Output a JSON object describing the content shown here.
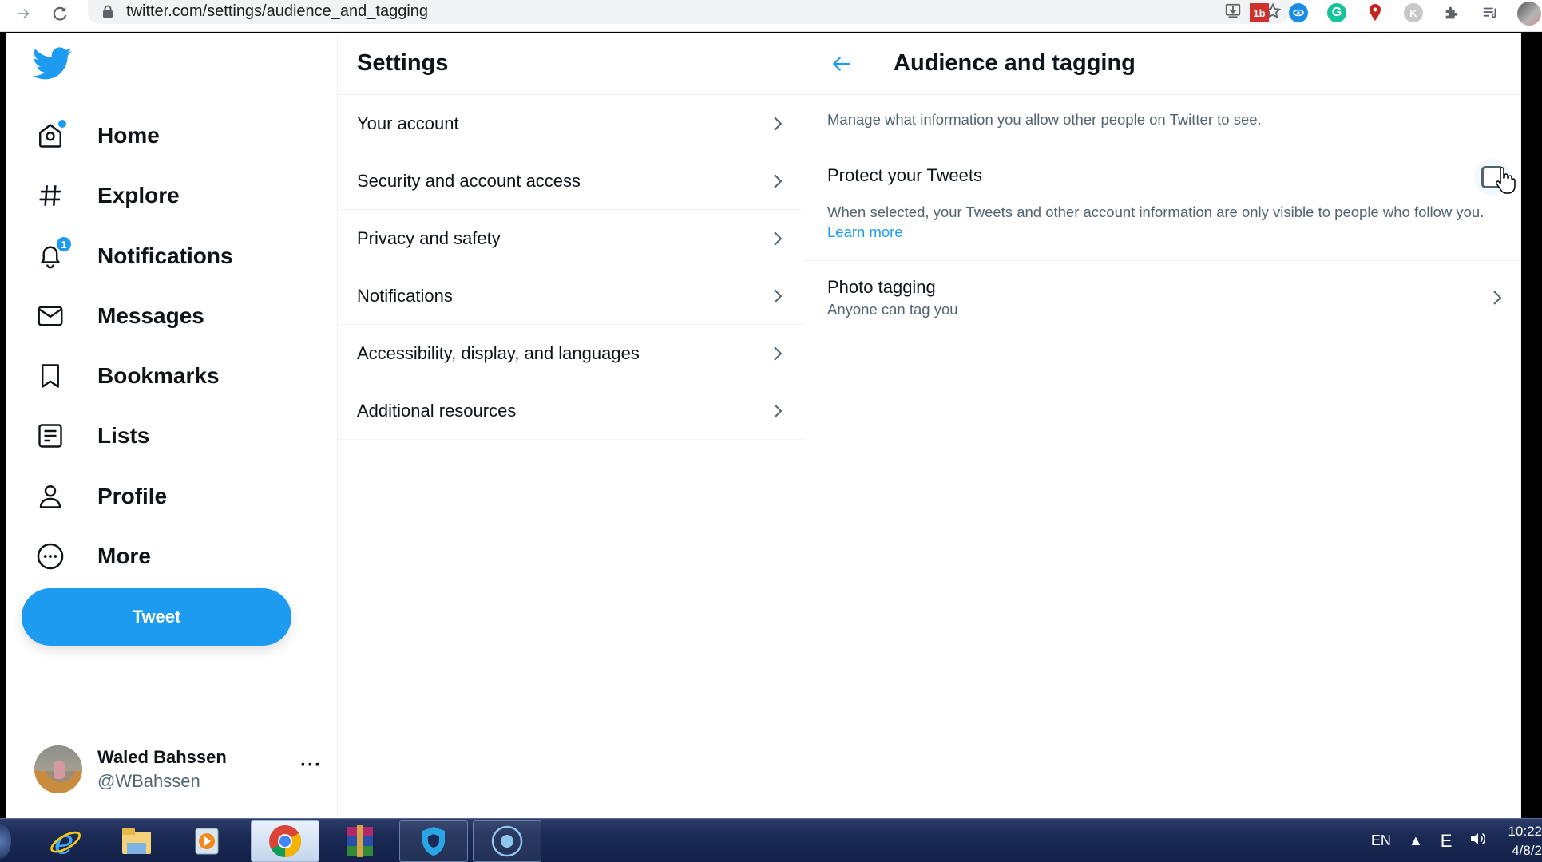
{
  "browser": {
    "url": "twitter.com/settings/audience_and_tagging",
    "icons": [
      "back-icon",
      "forward-icon",
      "reload-icon",
      "lock-icon",
      "install-icon",
      "star-icon",
      "extension-1b-icon",
      "extension-blue-icon",
      "grammarly-icon",
      "maps-pin-icon",
      "k-extension-icon",
      "puzzle-icon",
      "media-queue-icon",
      "profile-avatar-icon"
    ],
    "ext_labels": {
      "ext1": "1b",
      "grammarly": "G",
      "k": "K"
    }
  },
  "sidebar": {
    "items": [
      {
        "label": "Home",
        "icon": "home-icon",
        "has_dot": true
      },
      {
        "label": "Explore",
        "icon": "hashtag-icon"
      },
      {
        "label": "Notifications",
        "icon": "bell-icon",
        "badge": "1"
      },
      {
        "label": "Messages",
        "icon": "envelope-icon"
      },
      {
        "label": "Bookmarks",
        "icon": "bookmark-icon"
      },
      {
        "label": "Lists",
        "icon": "list-icon"
      },
      {
        "label": "Profile",
        "icon": "person-icon"
      },
      {
        "label": "More",
        "icon": "more-circle-icon"
      }
    ],
    "tweet_button": "Tweet",
    "account": {
      "name": "Waled Bahssen",
      "handle": "@WBahssen",
      "more": "···"
    }
  },
  "settings": {
    "title": "Settings",
    "items": [
      "Your account",
      "Security and account access",
      "Privacy and safety",
      "Notifications",
      "Accessibility, display, and languages",
      "Additional resources"
    ]
  },
  "detail": {
    "title": "Audience and tagging",
    "intro": "Manage what information you allow other people on Twitter to see.",
    "protect": {
      "title": "Protect your Tweets",
      "description": "When selected, your Tweets and other account information are only visible to people who follow you.",
      "learn_more": "Learn more",
      "checked": false
    },
    "photo_tagging": {
      "title": "Photo tagging",
      "subtitle": "Anyone can tag you"
    }
  },
  "colors": {
    "accent": "#1d9bf0",
    "text_primary": "#0f1419",
    "text_secondary": "#536471"
  },
  "taskbar": {
    "apps": [
      "internet-explorer-icon",
      "file-explorer-icon",
      "media-player-icon",
      "chrome-icon",
      "winrar-icon",
      "vpn-shield-icon",
      "circle-app-icon"
    ],
    "language": "EN",
    "tray_letter": "E",
    "time": "10:22",
    "date": "4/8/2"
  }
}
